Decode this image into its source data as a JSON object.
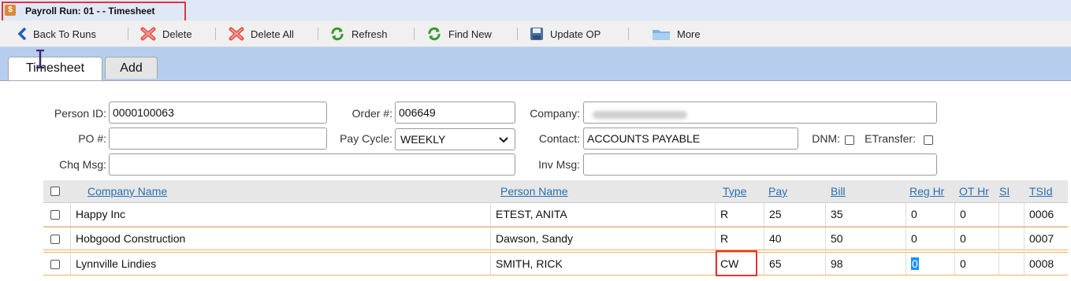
{
  "window": {
    "title": "Payroll Run: 01 - - Timesheet",
    "icon": "dollar-icon"
  },
  "toolbar": {
    "back": "Back To Runs",
    "delete": "Delete",
    "delete_all": "Delete All",
    "refresh": "Refresh",
    "find_new": "Find New",
    "update_op": "Update OP",
    "more": "More"
  },
  "tabs": [
    {
      "label": "Timesheet",
      "active": true
    },
    {
      "label": "Add",
      "active": false
    }
  ],
  "form": {
    "person_id_label": "Person ID:",
    "person_id_value": "0000100063",
    "order_label": "Order #:",
    "order_value": "006649",
    "company_label": "Company:",
    "company_value": "",
    "po_label": "PO #:",
    "po_value": "",
    "pay_cycle_label": "Pay Cycle:",
    "pay_cycle_value": "WEEKLY",
    "contact_label": "Contact:",
    "contact_value": "ACCOUNTS PAYABLE",
    "dnm_label": "DNM:",
    "etransfer_label": "ETransfer:",
    "chq_msg_label": "Chq Msg:",
    "chq_msg_value": "",
    "inv_msg_label": "Inv Msg:",
    "inv_msg_value": ""
  },
  "table": {
    "headers": [
      "Company Name",
      "Person Name",
      "Type",
      "Pay",
      "Bill",
      "Reg Hr",
      "OT Hr",
      "SI",
      "TSId"
    ],
    "rows": [
      {
        "company": "Happy Inc",
        "person": "ETEST, ANITA",
        "type": "R",
        "pay": "25",
        "bill": "35",
        "reg_hr": "0",
        "ot_hr": "0",
        "si": "",
        "tsid": "0006"
      },
      {
        "company": "Hobgood Construction",
        "person": "Dawson, Sandy",
        "type": "R",
        "pay": "40",
        "bill": "50",
        "reg_hr": "0",
        "ot_hr": "0",
        "si": "",
        "tsid": "0007"
      },
      {
        "company": "Lynnville Lindies",
        "person": "SMITH, RICK",
        "type": "CW",
        "pay": "65",
        "bill": "98",
        "reg_hr": "0",
        "ot_hr": "0",
        "si": "",
        "tsid": "0008"
      }
    ]
  },
  "colors": {
    "accent": "#2a6fb0",
    "tabstrip": "#b6cdee",
    "highlight_border": "#e0363a",
    "row_border": "#f3b05a"
  }
}
